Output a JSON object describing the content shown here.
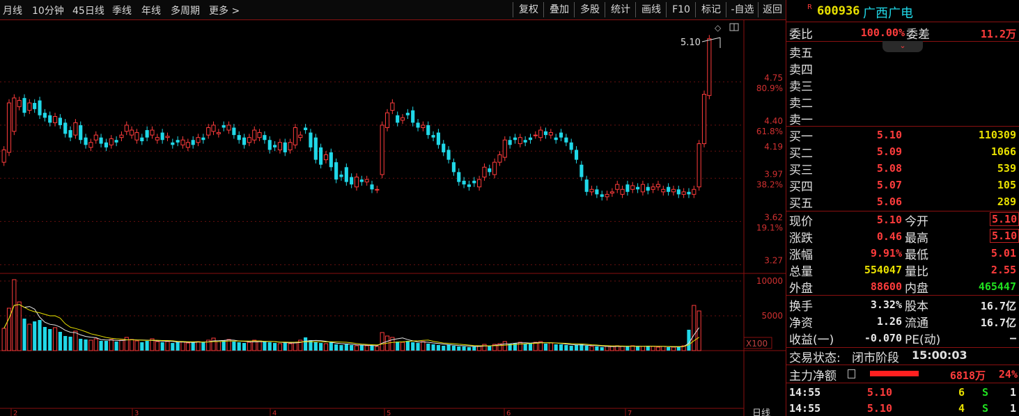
{
  "toolbar": {
    "left": [
      "月线",
      "10分钟",
      "45日线",
      "季线",
      "年线",
      "多周期",
      "更多 >"
    ],
    "right": [
      "复权",
      "叠加",
      "多股",
      "统计",
      "画线",
      "F10",
      "标记",
      "-自选",
      "返回"
    ]
  },
  "stock": {
    "badge": "R",
    "code": "600936",
    "name": "广西广电"
  },
  "weibi": {
    "label": "委比",
    "value": "100.00%",
    "diff_label": "委差",
    "diff_value": "11.2万"
  },
  "sell": [
    {
      "label": "卖五"
    },
    {
      "label": "卖四"
    },
    {
      "label": "卖三"
    },
    {
      "label": "卖二"
    },
    {
      "label": "卖一"
    }
  ],
  "buy": [
    {
      "label": "买一",
      "price": "5.10",
      "vol": "110309"
    },
    {
      "label": "买二",
      "price": "5.09",
      "vol": "1066"
    },
    {
      "label": "买三",
      "price": "5.08",
      "vol": "539"
    },
    {
      "label": "买四",
      "price": "5.07",
      "vol": "105"
    },
    {
      "label": "买五",
      "price": "5.06",
      "vol": "289"
    }
  ],
  "quote": [
    {
      "l1": "现价",
      "v1": "5.10",
      "l2": "今开",
      "v2": "5.10"
    },
    {
      "l1": "涨跌",
      "v1": "0.46",
      "l2": "最高",
      "v2": "5.10"
    },
    {
      "l1": "涨幅",
      "v1": "9.91%",
      "l2": "最低",
      "v2": "5.01"
    },
    {
      "l1": "总量",
      "v1": "554047",
      "l2": "量比",
      "v2": "2.55"
    },
    {
      "l1": "外盘",
      "v1": "88600",
      "l2": "内盘",
      "v2": "465447"
    }
  ],
  "fundamentals": [
    {
      "l1": "换手",
      "v1": "3.32%",
      "l2": "股本",
      "v2": "16.7亿"
    },
    {
      "l1": "净资",
      "v1": "1.26",
      "l2": "流通",
      "v2": "16.7亿"
    },
    {
      "l1": "收益(一)",
      "v1": "-0.070",
      "l2": "PE(动)",
      "v2": "—"
    }
  ],
  "status": {
    "label": "交易状态:",
    "value": "闭市阶段",
    "time": "15:00:03"
  },
  "mainflow": {
    "label": "主力净额",
    "value": "6818万",
    "pct": "24%"
  },
  "ticks": [
    {
      "time": "14:55",
      "price": "5.10",
      "vol": "6",
      "side": "S",
      "n": "1"
    },
    {
      "time": "14:55",
      "price": "5.10",
      "vol": "4",
      "side": "S",
      "n": "1"
    }
  ],
  "chart_data": {
    "type": "candlestick",
    "price_ticks": [
      "4.75",
      "4.40",
      "4.19",
      "3.97",
      "3.62",
      "3.27"
    ],
    "pct_ticks": [
      "80.9%",
      "61.8%",
      "38.2%",
      "19.1%"
    ],
    "last_price_label": "5.10",
    "volume_ticks": [
      "10000",
      "5000"
    ],
    "volume_unit": "X100",
    "bottom_label": "日线",
    "ylim": [
      3.2,
      5.25
    ],
    "open": [
      4.1,
      4.18,
      4.35,
      4.55,
      4.62,
      4.52,
      4.58,
      4.6,
      4.5,
      4.48,
      4.42,
      4.46,
      4.42,
      4.36,
      4.32,
      4.4,
      4.3,
      4.22,
      4.28,
      4.3,
      4.26,
      4.24,
      4.28,
      4.3,
      4.35,
      4.32,
      4.28,
      4.3,
      4.36,
      4.32,
      4.28,
      4.34,
      4.3,
      4.26,
      4.28,
      4.24,
      4.22,
      4.28,
      4.26,
      4.3,
      4.32,
      4.35,
      4.33,
      4.4,
      4.36,
      4.38,
      4.32,
      4.3,
      4.26,
      4.28,
      4.3,
      4.32,
      4.28,
      4.24,
      4.2,
      4.26,
      4.2,
      4.24,
      4.3,
      4.38,
      4.34,
      4.3,
      4.22,
      4.12,
      4.18,
      4.1,
      4.0,
      4.06,
      3.98,
      3.9,
      3.96,
      3.94,
      3.92,
      3.88,
      4.0,
      4.38,
      4.52,
      4.48,
      4.44,
      4.5,
      4.52,
      4.42,
      4.38,
      4.4,
      4.32,
      4.34,
      4.25,
      4.2,
      4.1,
      4.02,
      3.95,
      3.92,
      3.95,
      3.9,
      3.98,
      4.05,
      4.0,
      4.1,
      4.14,
      4.28,
      4.3,
      4.25,
      4.28,
      4.3,
      4.32,
      4.3,
      4.35,
      4.32,
      4.3,
      4.34,
      4.3,
      4.26,
      4.2,
      4.08,
      3.96,
      3.86,
      3.88,
      3.84,
      3.82,
      3.85,
      3.88,
      3.84,
      3.92,
      3.88,
      3.9,
      3.86,
      3.9,
      3.88,
      3.9,
      3.86,
      3.9,
      3.86,
      3.88,
      3.84,
      3.86,
      3.84,
      3.9,
      4.25,
      4.64
    ],
    "close": [
      4.2,
      4.58,
      4.62,
      4.6,
      4.5,
      4.58,
      4.53,
      4.48,
      4.46,
      4.42,
      4.47,
      4.4,
      4.33,
      4.3,
      4.42,
      4.28,
      4.24,
      4.26,
      4.32,
      4.25,
      4.22,
      4.29,
      4.26,
      4.32,
      4.4,
      4.36,
      4.34,
      4.27,
      4.3,
      4.36,
      4.3,
      4.28,
      4.31,
      4.24,
      4.26,
      4.28,
      4.26,
      4.24,
      4.3,
      4.28,
      4.38,
      4.4,
      4.34,
      4.38,
      4.4,
      4.32,
      4.28,
      4.24,
      4.3,
      4.36,
      4.34,
      4.28,
      4.2,
      4.22,
      4.26,
      4.18,
      4.26,
      4.38,
      4.32,
      4.36,
      4.22,
      4.12,
      4.08,
      4.16,
      4.06,
      3.96,
      3.98,
      3.94,
      3.92,
      3.98,
      3.94,
      3.96,
      3.88,
      3.88,
      4.4,
      4.5,
      4.58,
      4.42,
      4.46,
      4.48,
      4.42,
      4.38,
      4.4,
      4.32,
      4.3,
      4.24,
      4.18,
      4.12,
      4.02,
      3.94,
      3.92,
      3.9,
      3.93,
      3.96,
      4.06,
      4.02,
      4.1,
      4.16,
      4.28,
      4.24,
      4.28,
      4.3,
      4.26,
      4.28,
      4.32,
      4.36,
      4.32,
      4.34,
      4.28,
      4.3,
      4.26,
      4.2,
      4.12,
      3.98,
      3.86,
      3.88,
      3.84,
      3.82,
      3.84,
      3.86,
      3.92,
      3.88,
      3.86,
      3.91,
      3.88,
      3.92,
      3.87,
      3.9,
      3.92,
      3.88,
      3.86,
      3.88,
      3.84,
      3.86,
      3.84,
      3.88,
      4.25,
      4.65,
      5.1
    ],
    "volume": [
      3200,
      6100,
      10200,
      7000,
      4600,
      3800,
      4200,
      4400,
      3400,
      3100,
      3300,
      2700,
      2100,
      2000,
      2800,
      1700,
      1600,
      1500,
      1700,
      1400,
      1400,
      1600,
      1300,
      1500,
      1900,
      1600,
      1400,
      1200,
      1400,
      1700,
      1300,
      1200,
      1300,
      1100,
      1200,
      1300,
      1100,
      1200,
      1300,
      1200,
      1500,
      1800,
      1300,
      1500,
      1600,
      1300,
      1200,
      1100,
      1200,
      1500,
      1400,
      1300,
      1200,
      1100,
      1000,
      1200,
      1000,
      1200,
      1500,
      1900,
      1500,
      1200,
      1100,
      1000,
      1200,
      900,
      800,
      900,
      800,
      700,
      800,
      700,
      700,
      600,
      2600,
      2100,
      1900,
      1300,
      1200,
      1400,
      1200,
      1100,
      1300,
      1000,
      900,
      800,
      700,
      900,
      700,
      600,
      600,
      500,
      600,
      700,
      900,
      700,
      900,
      1000,
      1300,
      1000,
      1100,
      1200,
      1000,
      1100,
      1200,
      1300,
      1000,
      1100,
      900,
      900,
      800,
      700,
      800,
      900,
      700,
      600,
      600,
      500,
      600,
      600,
      700,
      600,
      600,
      700,
      600,
      600,
      700,
      600,
      500,
      600,
      500,
      500,
      600,
      700,
      3000,
      6500,
      5700
    ],
    "date_labels": [
      "2",
      "3",
      "4",
      "5",
      "6",
      "7"
    ]
  }
}
